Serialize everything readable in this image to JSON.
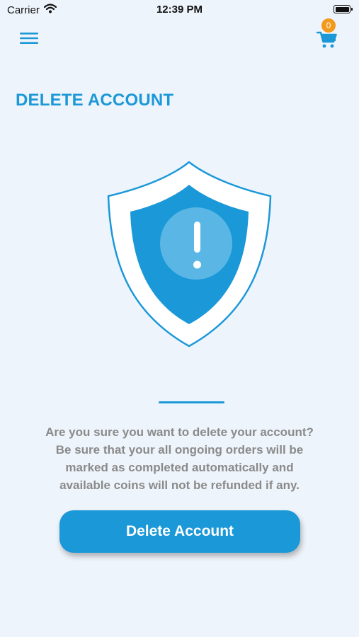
{
  "status_bar": {
    "carrier": "Carrier",
    "time": "12:39 PM",
    "wifi_icon": "wifi-icon",
    "battery_icon": "battery-icon"
  },
  "header": {
    "menu_icon": "hamburger-menu-icon",
    "cart_icon": "shopping-cart-icon",
    "cart_count": "0"
  },
  "page": {
    "title": "DELETE ACCOUNT",
    "illustration_icon": "shield-warning-icon",
    "message_lines": [
      "Are you sure you want to delete your account?",
      "Be sure that your all ongoing orders will be",
      "marked as completed automatically and",
      "available coins will not be refunded if any."
    ],
    "delete_button_label": "Delete Account"
  },
  "colors": {
    "accent": "#1b98d8",
    "badge": "#f29a1b",
    "background": "#eef4fb",
    "message_text": "#8a8a8a"
  }
}
